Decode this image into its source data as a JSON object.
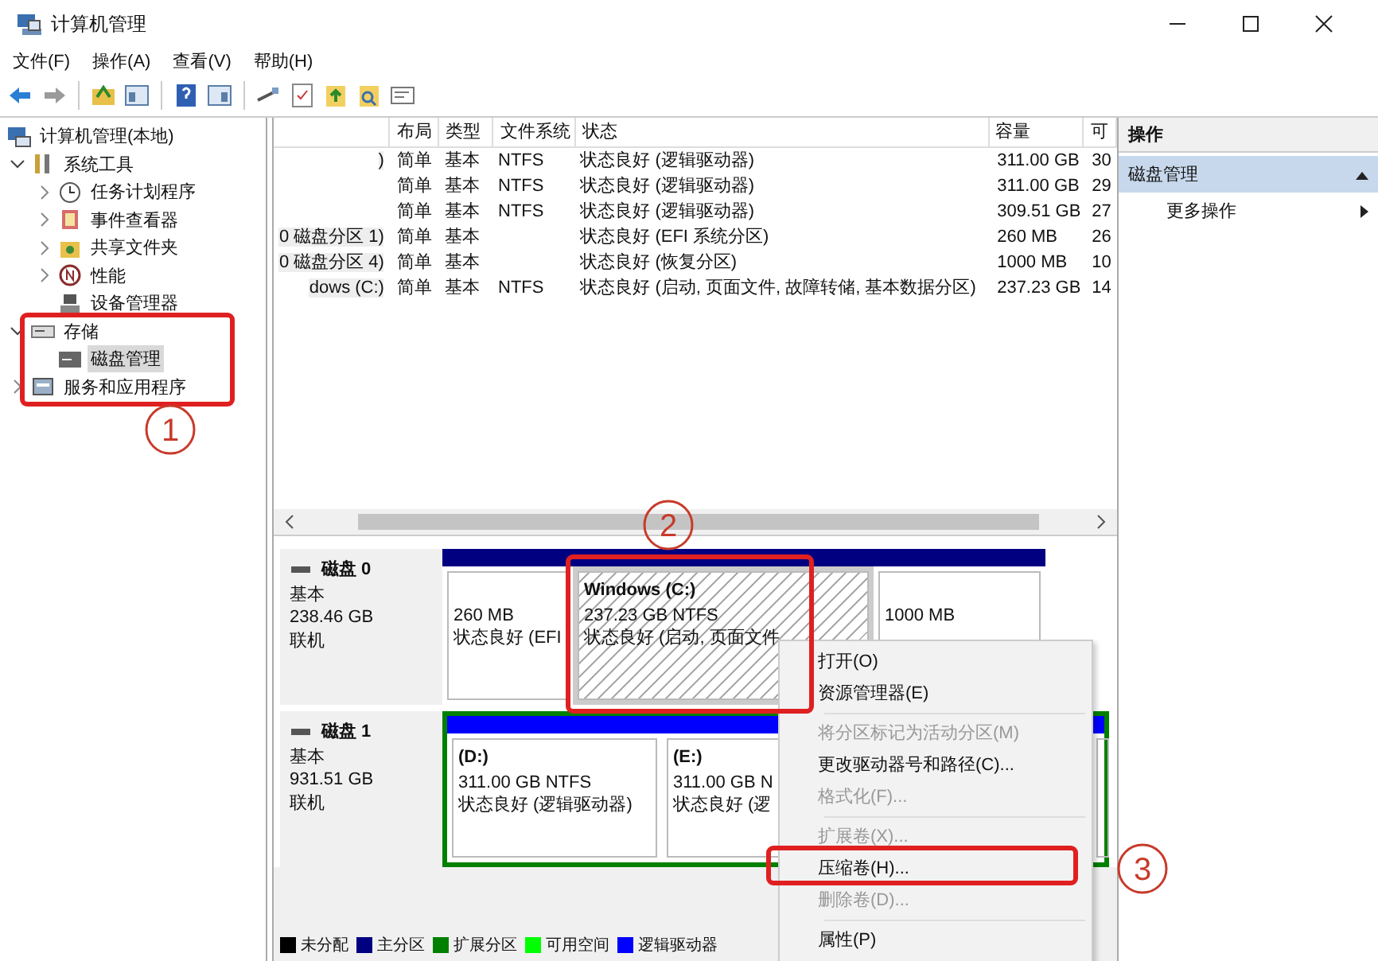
{
  "window": {
    "title": "计算机管理"
  },
  "menu_bar": [
    "文件(F)",
    "操作(A)",
    "查看(V)",
    "帮助(H)"
  ],
  "tree": [
    {
      "label": "计算机管理(本地)",
      "kind": "computer",
      "selected": false,
      "children": [
        {
          "label": "系统工具",
          "kind": "tools",
          "expanded": true,
          "selected": false,
          "children": [
            {
              "label": "任务计划程序",
              "kind": "clock",
              "expanded": false,
              "selected": false
            },
            {
              "label": "事件查看器",
              "kind": "event",
              "expanded": false,
              "selected": false
            },
            {
              "label": "共享文件夹",
              "kind": "share",
              "expanded": false,
              "selected": false
            },
            {
              "label": "性能",
              "kind": "perf",
              "expanded": false,
              "selected": false
            },
            {
              "label": "设备管理器",
              "kind": "device",
              "selected": false
            }
          ]
        },
        {
          "label": "存储",
          "kind": "storage",
          "expanded": true,
          "selected": false,
          "children": [
            {
              "label": "磁盘管理",
              "kind": "disk",
              "selected": true
            }
          ]
        },
        {
          "label": "服务和应用程序",
          "kind": "services",
          "expanded": false,
          "selected": false
        }
      ]
    }
  ],
  "table": {
    "columns": [
      "布局",
      "类型",
      "文件系统",
      "状态",
      "容量",
      "可"
    ],
    "rows": [
      {
        "column_1": ")",
        "layout": "简单",
        "type": "基本",
        "file_system": "NTFS",
        "status": "状态良好 (逻辑驱动器)",
        "capacity": "311.00 GB",
        "column_7": "30"
      },
      {
        "layout": "简单",
        "type": "基本",
        "file_system": "NTFS",
        "status": "状态良好 (逻辑驱动器)",
        "capacity": "311.00 GB",
        "column_7": "29"
      },
      {
        "layout": "简单",
        "type": "基本",
        "file_system": "NTFS",
        "status": "状态良好 (逻辑驱动器)",
        "capacity": "309.51 GB",
        "column_7": "27"
      },
      {
        "column_1": "0 磁盘分区 1)",
        "layout": "简单",
        "type": "基本",
        "status": "状态良好 (EFI 系统分区)",
        "capacity": "260 MB",
        "column_7": "26"
      },
      {
        "column_1": "0 磁盘分区 4)",
        "layout": "简单",
        "type": "基本",
        "status": "状态良好 (恢复分区)",
        "capacity": "1000 MB",
        "column_7": "10"
      },
      {
        "column_1": "dows (C:)",
        "layout": "简单",
        "type": "基本",
        "file_system": "NTFS",
        "status": "状态良好 (启动, 页面文件, 故障转储, 基本数据分区)",
        "capacity": "237.23 GB",
        "column_7": "14"
      }
    ]
  },
  "disks": [
    {
      "name": "磁盘 0",
      "type": "基本",
      "size": "238.46 GB",
      "state": "联机",
      "partitions": [
        {
          "kind": "primary",
          "selected": false,
          "lines": [
            "260 MB",
            "状态良好 (EFI"
          ]
        },
        {
          "kind": "primary",
          "selected": true,
          "title": "Windows  (C:)",
          "lines": [
            "237.23 GB NTFS",
            "状态良好 (启动, 页面文件"
          ]
        },
        {
          "kind": "primary",
          "selected": false,
          "lines": [
            "1000 MB"
          ]
        }
      ]
    },
    {
      "name": "磁盘 1",
      "type": "基本",
      "size": "931.51 GB",
      "state": "联机",
      "partitions": [
        {
          "kind": "extended",
          "selected": false,
          "children": [
            {
              "kind": "logical",
              "selected": false,
              "title": "(D:)",
              "lines": [
                "311.00 GB NTFS",
                "状态良好 (逻辑驱动器)"
              ]
            },
            {
              "kind": "logical",
              "selected": false,
              "title": "(E:)",
              "lines": [
                "311.00 GB N",
                "状态良好 (逻"
              ]
            },
            {
              "kind": "logical"
            }
          ]
        }
      ]
    }
  ],
  "legend": [
    {
      "label": "未分配",
      "color": "#000000"
    },
    {
      "label": "主分区",
      "color": "#000080"
    },
    {
      "label": "扩展分区",
      "color": "#008000"
    },
    {
      "label": "可用空间",
      "color": "#00ff00"
    },
    {
      "label": "逻辑驱动器",
      "color": "#0000ff"
    }
  ],
  "actions": {
    "title": "操作",
    "section": {
      "label": "磁盘管理",
      "expanded": true
    },
    "items": [
      "更多操作"
    ]
  },
  "context_menu": [
    {
      "kind": "item",
      "label": "打开(O)",
      "disabled": false
    },
    {
      "kind": "item",
      "label": "资源管理器(E)",
      "disabled": false
    },
    {
      "kind": "separator"
    },
    {
      "kind": "item",
      "label": "将分区标记为活动分区(M)",
      "disabled": true
    },
    {
      "kind": "item",
      "label": "更改驱动器号和路径(C)...",
      "disabled": false
    },
    {
      "kind": "item",
      "label": "格式化(F)...",
      "disabled": true
    },
    {
      "kind": "separator"
    },
    {
      "kind": "item",
      "label": "扩展卷(X)...",
      "disabled": true
    },
    {
      "kind": "item",
      "label": "压缩卷(H)...",
      "disabled": false
    },
    {
      "kind": "item",
      "label": "删除卷(D)...",
      "disabled": true
    },
    {
      "kind": "separator"
    },
    {
      "kind": "item",
      "label": "属性(P)",
      "disabled": false
    }
  ],
  "annotations": [
    {
      "label": "1"
    },
    {
      "label": "2"
    },
    {
      "label": "3"
    }
  ]
}
